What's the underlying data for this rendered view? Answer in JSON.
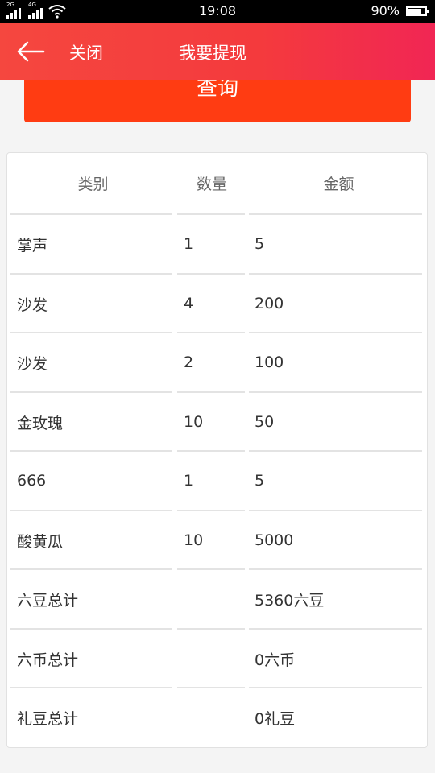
{
  "status_bar": {
    "signal1_tag": "2G",
    "signal2_tag": "4G",
    "time": "19:08",
    "battery_text": "90%",
    "battery_level": 0.9
  },
  "header": {
    "back_icon": "arrow-left-icon",
    "close_label": "关闭",
    "title": "我要提现"
  },
  "query_button": {
    "label": "查询"
  },
  "table": {
    "headers": [
      "类别",
      "数量",
      "金额"
    ],
    "rows": [
      [
        "掌声",
        "1",
        "5"
      ],
      [
        "沙发",
        "4",
        "200"
      ],
      [
        "沙发",
        "2",
        "100"
      ],
      [
        "金玫瑰",
        "10",
        "50"
      ],
      [
        "666",
        "1",
        "5"
      ],
      [
        "酸黄瓜",
        "10",
        "5000"
      ],
      [
        "六豆总计",
        "",
        "5360六豆"
      ],
      [
        "六币总计",
        "",
        "0六币"
      ],
      [
        "礼豆总计",
        "",
        "0礼豆"
      ]
    ]
  }
}
